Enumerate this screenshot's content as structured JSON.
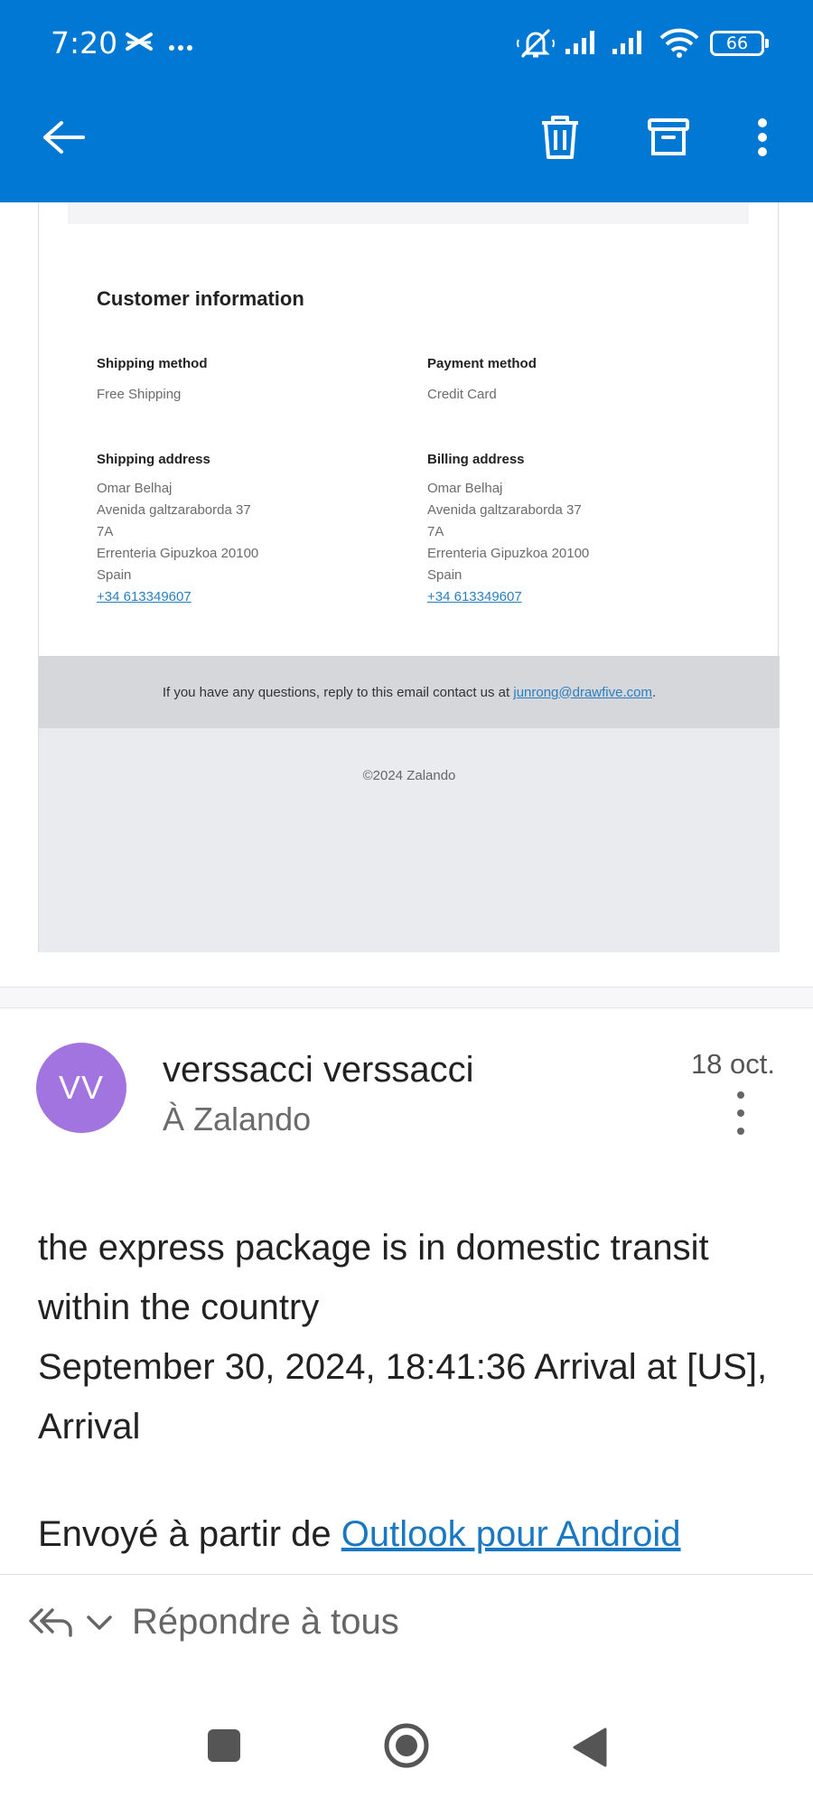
{
  "status_bar": {
    "time": "7:20",
    "battery": "66",
    "icons": [
      "capcut-icon",
      "more-notifications-icon",
      "mute-icon",
      "signal-icon",
      "signal-icon",
      "wifi-icon",
      "battery-icon"
    ]
  },
  "app_bar": {
    "accent": "#0078d4",
    "icons": [
      "back-arrow-icon",
      "trash-icon",
      "archive-icon",
      "more-vert-icon"
    ]
  },
  "email_card": {
    "heading": "Customer information",
    "shipping_method": {
      "label": "Shipping method",
      "value": "Free Shipping"
    },
    "payment_method": {
      "label": "Payment method",
      "value": "Credit Card"
    },
    "shipping_address": {
      "label": "Shipping address",
      "lines": [
        "Omar Belhaj",
        "Avenida galtzaraborda 37",
        "7A",
        "Errenteria Gipuzkoa 20100",
        "Spain"
      ],
      "phone": "+34 613349607"
    },
    "billing_address": {
      "label": "Billing address",
      "lines": [
        "Omar Belhaj",
        "Avenida galtzaraborda 37",
        "7A",
        "Errenteria Gipuzkoa 20100",
        "Spain"
      ],
      "phone": "+34 613349607"
    },
    "footer": {
      "text_before": "If you have any questions, reply to this email contact us at ",
      "email": "junrong@drawfive.com",
      "text_after": "."
    },
    "copyright": "©2024 Zalando"
  },
  "message": {
    "avatar_initials": "VV",
    "avatar_color": "#a274e0",
    "sender": "verssacci verssacci",
    "recipient": "À Zalando",
    "date": "18 oct.",
    "body_lines": [
      "the express package is in domestic transit within the country",
      "September 30, 2024, 18:41:36 Arrival at [US], Arrival"
    ],
    "signature_prefix": "Envoyé à partir de ",
    "signature_link": "Outlook pour Android"
  },
  "reply_bar": {
    "label": "Répondre à tous"
  },
  "nav_bar": {
    "icons": [
      "recent-apps-icon",
      "home-icon",
      "back-icon"
    ]
  }
}
